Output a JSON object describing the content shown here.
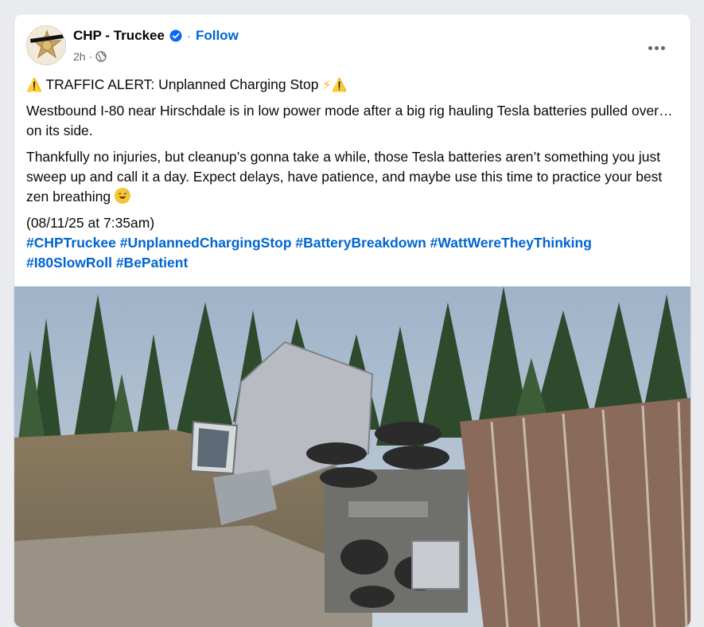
{
  "post": {
    "author": "CHP - Truckee",
    "follow_label": "Follow",
    "time": "2h",
    "separator": "·",
    "alert_line": "TRAFFIC ALERT: Unplanned Charging Stop",
    "paragraph1": "Westbound I-80 near Hirschdale is in low power mode after a big rig hauling Tesla batteries pulled over… on its side.",
    "paragraph2": "Thankfully no injuries, but cleanup’s gonna take a while, those Tesla batteries aren’t something you just sweep up and call it a day. Expect delays, have patience, and maybe use this time to practice your best zen breathing",
    "date_line": "(08/11/25 at 7:35am)",
    "hashtags": [
      "#CHPTruckee",
      "#UnplannedChargingStop",
      "#BatteryBreakdown",
      "#WattWereTheyThinking",
      "#I80SlowRoll",
      "#BePatient"
    ],
    "icons": {
      "avatar": "chp-star-badge",
      "verified": "verified-badge-icon",
      "privacy": "globe-icon",
      "more": "more-options-icon",
      "emoji_warning": "⚠️",
      "emoji_bolt": "⚡",
      "emoji_smile": "😅"
    },
    "colors": {
      "link": "#0064d1",
      "meta": "#65676b",
      "verified": "#0866ff"
    }
  }
}
